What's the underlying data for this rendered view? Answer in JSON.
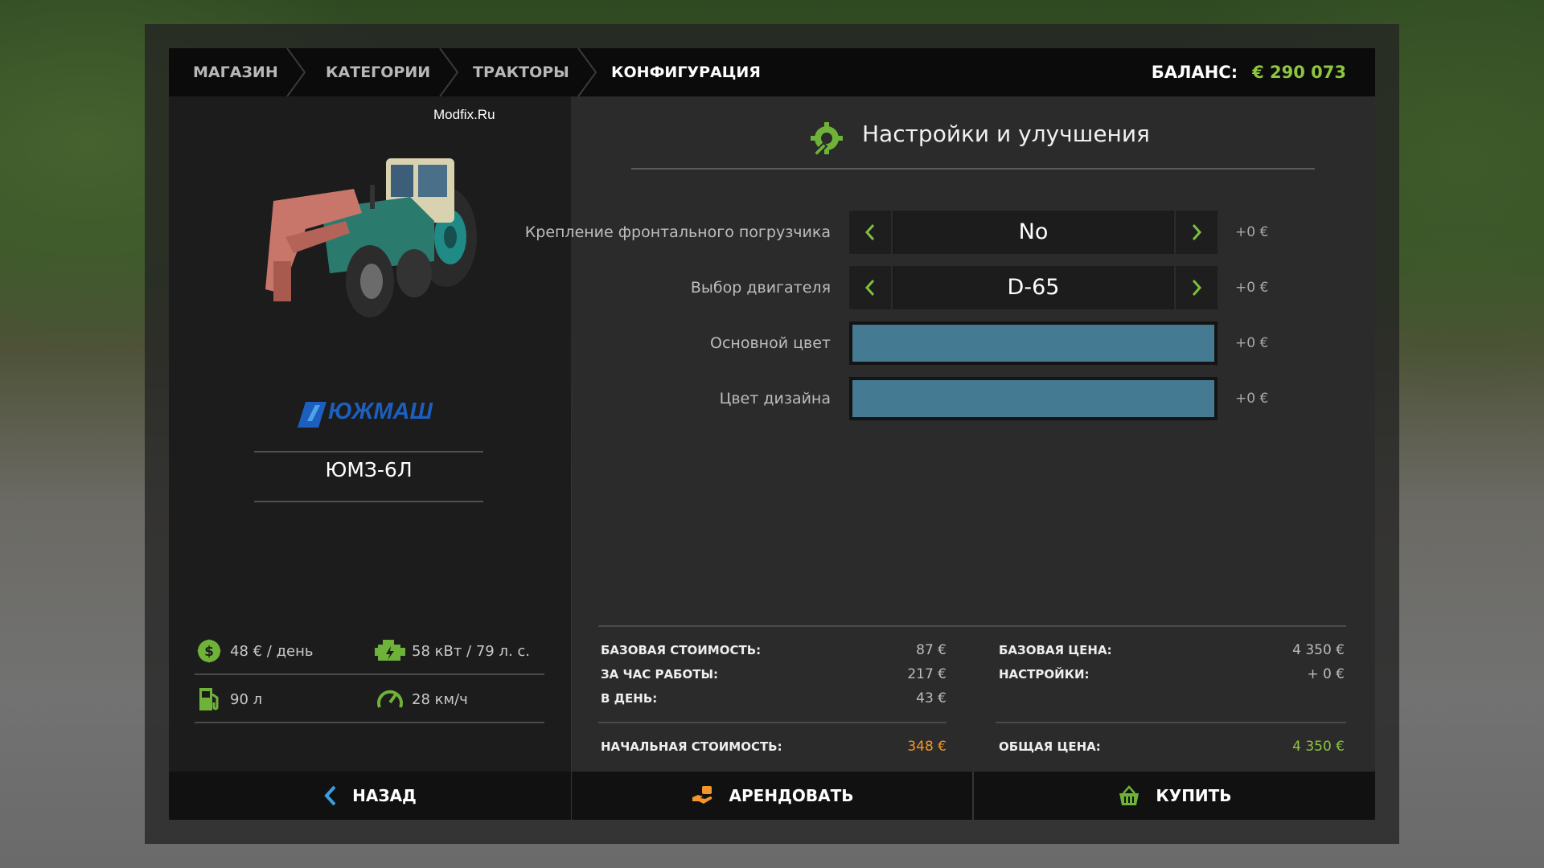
{
  "header": {
    "breadcrumbs": [
      "МАГАЗИН",
      "КАТЕГОРИИ",
      "ТРАКТОРЫ",
      "КОНФИГУРАЦИЯ"
    ],
    "balance_label": "БАЛАНС:",
    "balance_amount": "€ 290 073"
  },
  "vehicle": {
    "watermark": "Modfix.Ru",
    "brand": "ЮЖМАШ",
    "model": "ЮМЗ-6Л",
    "stats": {
      "daily_cost": "48 € / день",
      "power": "58 кВт / 79 л. с.",
      "fuel": "90 л",
      "speed": "28 км/ч"
    }
  },
  "config": {
    "title": "Настройки и улучшения",
    "options": [
      {
        "label": "Крепление фронтального погрузчика",
        "value": "No",
        "price": "+0 €"
      },
      {
        "label": "Выбор двигателя",
        "value": "D-65",
        "price": "+0 €"
      }
    ],
    "colors": [
      {
        "label": "Основной цвет",
        "color": "#447a92",
        "price": "+0 €"
      },
      {
        "label": "Цвет дизайна",
        "color": "#447a92",
        "price": "+0 €"
      }
    ]
  },
  "costs": {
    "lease": {
      "base_label": "БАЗОВАЯ СТОИМОСТЬ:",
      "base_value": "87 €",
      "hour_label": "ЗА ЧАС РАБОТЫ:",
      "hour_value": "217 €",
      "day_label": "В ДЕНЬ:",
      "day_value": "43 €",
      "initial_label": "НАЧАЛЬНАЯ СТОИМОСТЬ:",
      "initial_value": "348 €"
    },
    "buy": {
      "base_label": "БАЗОВАЯ ЦЕНА:",
      "base_value": "4 350 €",
      "config_label": "НАСТРОЙКИ:",
      "config_value": "+ 0 €",
      "total_label": "ОБЩАЯ ЦЕНА:",
      "total_value": "4 350 €"
    }
  },
  "actions": {
    "back": "НАЗАД",
    "lease": "АРЕНДОВАТЬ",
    "buy": "КУПИТЬ"
  },
  "colors": {
    "accent_green": "#8dc63f",
    "accent_orange": "#f0962b",
    "brand_blue": "#1c5fbf"
  }
}
